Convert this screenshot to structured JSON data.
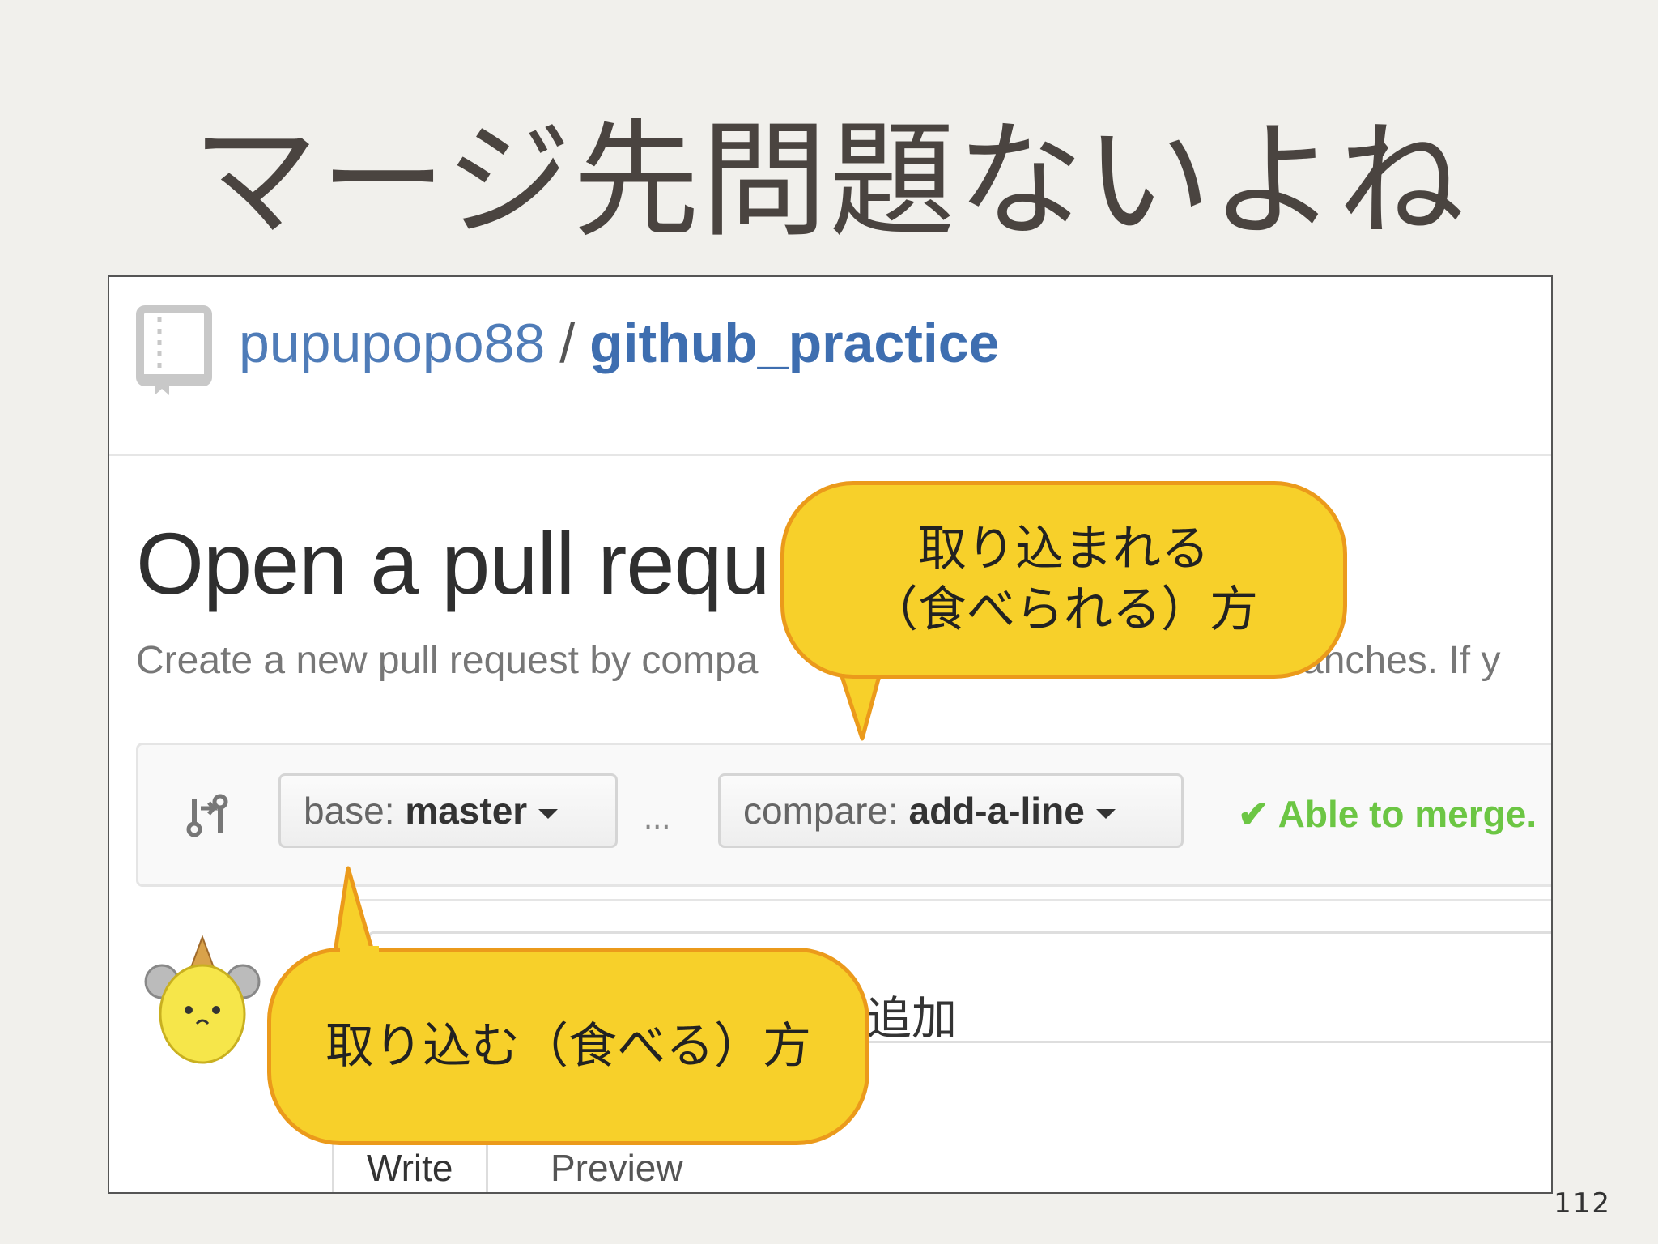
{
  "slide": {
    "title": "マージ先問題ないよね",
    "page_number": "112"
  },
  "github": {
    "owner": "pupupopo88",
    "separator": "/",
    "repo": "github_practice",
    "heading": "Open a pull requ",
    "description": "Create a new pull request by compa",
    "description_tail": "anches. If y",
    "base_prefix": "base: ",
    "base_branch": "master",
    "ellipsis": "...",
    "compare_prefix": "compare: ",
    "compare_branch": "add-a-line",
    "merge_check": "✔",
    "merge_status": "Able to merge.",
    "title_input_value": "追加",
    "tabs": {
      "write": "Write",
      "preview": "Preview"
    }
  },
  "callouts": {
    "head_line1": "取り込まれる",
    "head_line2": "（食べられる）方",
    "base": "取り込む（食べる）方"
  },
  "colors": {
    "link": "#4f7cb8",
    "merge_ok": "#6cc644",
    "callout_fill": "#f7d02a",
    "callout_border": "#eb9a1b"
  }
}
